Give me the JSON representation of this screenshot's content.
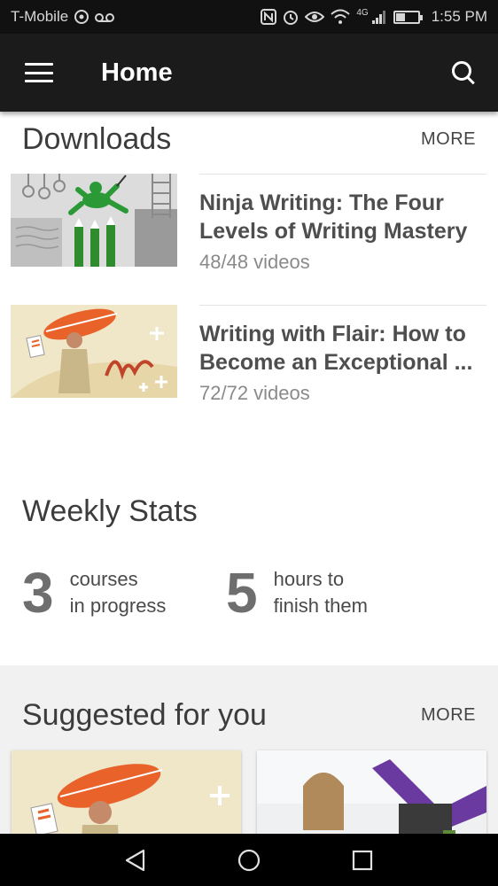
{
  "status_bar": {
    "carrier": "T-Mobile",
    "network": "4G",
    "time": "1:55 PM",
    "battery_level": 0.4
  },
  "app_bar": {
    "title": "Home",
    "menu_icon": "hamburger-menu-icon",
    "search_icon": "search-icon"
  },
  "downloads": {
    "title": "Downloads",
    "more_label": "MORE",
    "items": [
      {
        "title_line1": "Ninja Writing: The Four",
        "title_line2": "Levels of Writing Mastery",
        "subtitle": "48/48 videos"
      },
      {
        "title_line1": "Writing with Flair: How to",
        "title_line2": "Become an Exceptional ...",
        "subtitle": "72/72 videos"
      }
    ]
  },
  "weekly_stats": {
    "title": "Weekly Stats",
    "stats": [
      {
        "value": "3",
        "label_line1": "courses",
        "label_line2": "in progress"
      },
      {
        "value": "5",
        "label_line1": "hours to",
        "label_line2": "finish them"
      }
    ]
  },
  "suggested": {
    "title": "Suggested for you",
    "more_label": "MORE"
  },
  "colors": {
    "app_bar": "#1b1b1b",
    "background": "#f1f1f1",
    "accent_orange": "#e8622a",
    "ninja_green": "#2e8b2e"
  }
}
